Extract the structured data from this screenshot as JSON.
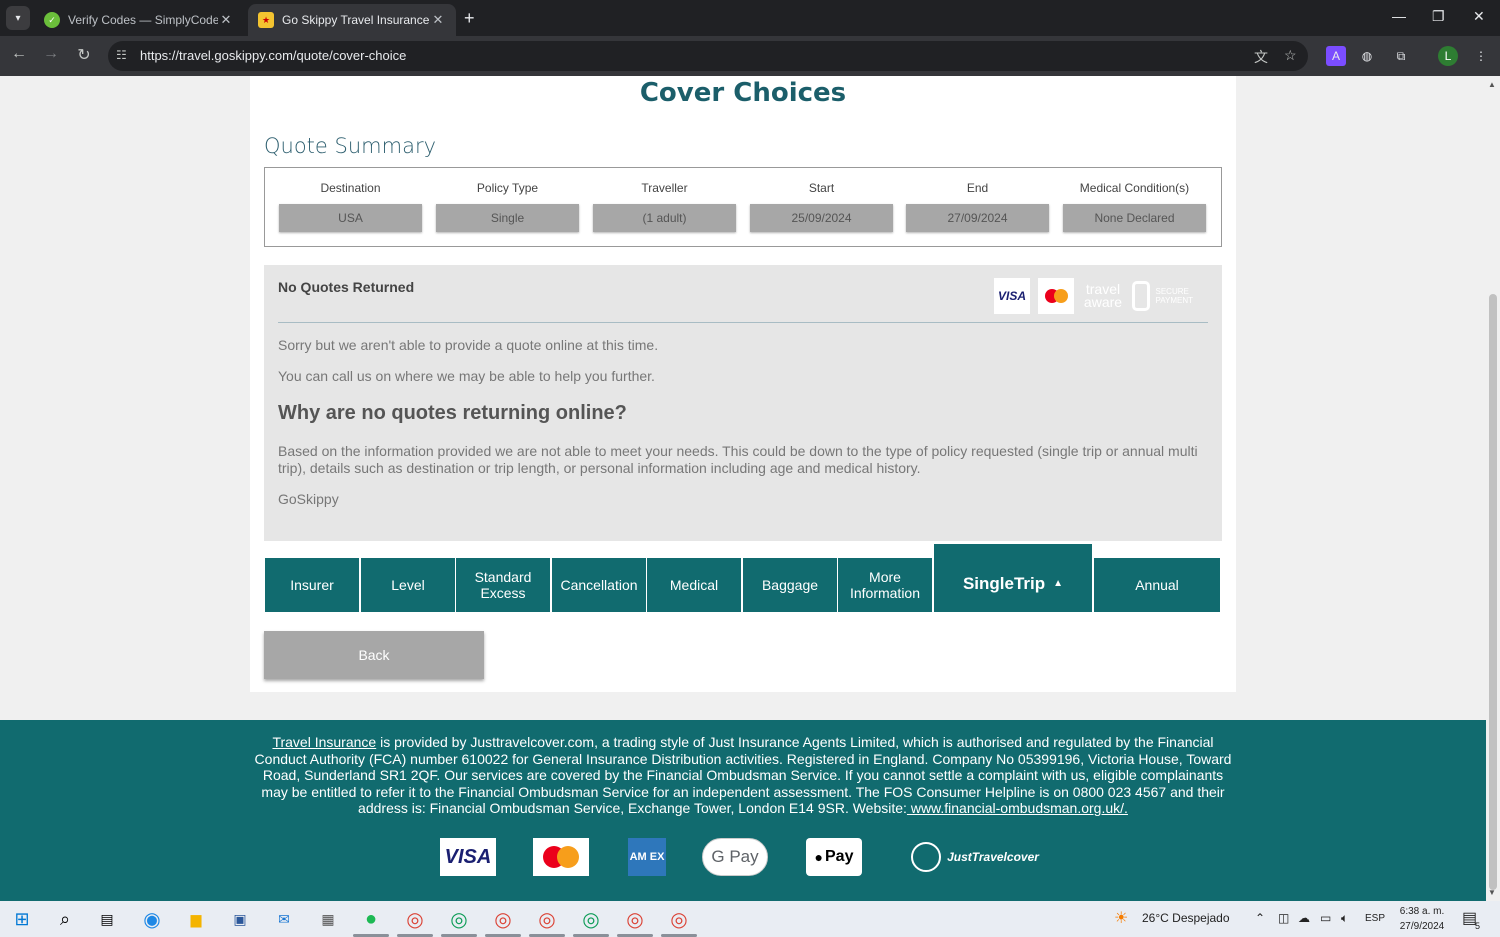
{
  "browser": {
    "tabs": [
      {
        "title": "Verify Codes — SimplyCodes",
        "active": false
      },
      {
        "title": "Go Skippy Travel Insurance | Co",
        "active": true
      }
    ],
    "url": "https://travel.goskippy.com/quote/cover-choice",
    "profile_initial": "L"
  },
  "page": {
    "title": "Cover Choices",
    "quote_summary": {
      "title": "Quote Summary",
      "fields": [
        {
          "label": "Destination",
          "value": "USA"
        },
        {
          "label": "Policy Type",
          "value": "Single"
        },
        {
          "label": "Traveller",
          "value": "(1 adult)"
        },
        {
          "label": "Start",
          "value": "25/09/2024"
        },
        {
          "label": "End",
          "value": "27/09/2024"
        },
        {
          "label": "Medical Condition(s)",
          "value": "None Declared"
        }
      ]
    },
    "no_quotes": {
      "heading": "No Quotes Returned",
      "p1": "Sorry but we aren't able to provide a quote online at this time.",
      "p2": "You can call us on where we may be able to help you further.",
      "why_heading": "Why are no quotes returning online?",
      "why_text": "Based on the information provided we are not able to meet your needs. This could be down to the type of policy requested (single trip or annual multi trip), details such as destination or trip length, or personal information including age and medical history.",
      "signoff": "GoSkippy",
      "badges": {
        "visa": "VISA",
        "mastercard": "MasterCard",
        "travel_aware": "travel aware",
        "secure_payment": "SECURE PAYMENT"
      }
    },
    "cover_tabs": [
      {
        "label": "Insurer"
      },
      {
        "label": "Level"
      },
      {
        "label": "Standard Excess"
      },
      {
        "label": "Cancellation"
      },
      {
        "label": "Medical"
      },
      {
        "label": "Baggage"
      },
      {
        "label": "More Information"
      },
      {
        "label": "SingleTrip",
        "active": true
      },
      {
        "label": "Annual"
      }
    ],
    "back_label": "Back"
  },
  "footer": {
    "link_text": "Travel Insurance",
    "body": " is provided by Justtravelcover.com, a trading style of Just Insurance Agents Limited, which is authorised and regulated by the Financial Conduct Authority (FCA) number 610022 for General Insurance Distribution activities. Registered in England. Company No 05399196, Victoria House, Toward Road, Sunderland SR1 2QF. Our services are covered by the Financial Ombudsman Service. If you cannot settle a complaint with us, eligible complainants may be entitled to refer it to the Financial Ombudsman Service for an independent assessment. The FOS Consumer Helpline is on 0800 023 4567 and their address is: Financial Ombudsman Service, Exchange Tower, London E14 9SR. Website:",
    "website_link": " www.financial-ombudsman.org.uk/.",
    "payments": {
      "visa": "VISA",
      "mastercard": "MasterCard",
      "amex": "AM EX",
      "gpay": "G Pay",
      "applepay": "Pay",
      "jtc": "JustTravelcover"
    }
  },
  "taskbar": {
    "weather": "26°C  Despejado",
    "lang": "ESP",
    "time": "6:38 a. m.",
    "date": "27/9/2024",
    "notif_count": "5"
  },
  "colors": {
    "accent": "#116b6f",
    "title": "#1b5e6a",
    "panel": "#e6e6e6",
    "field": "#a7a7a7"
  }
}
